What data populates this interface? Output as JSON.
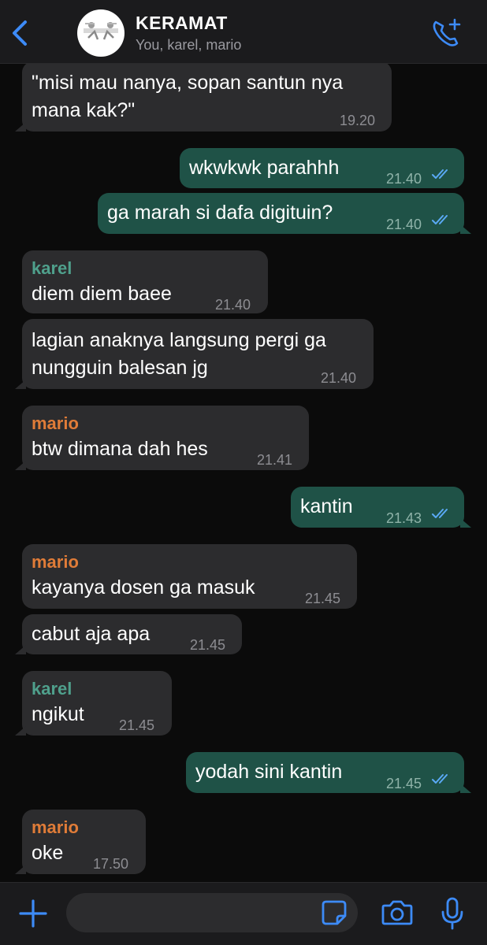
{
  "header": {
    "title": "KERAMAT",
    "subtitle": "You, karel, mario",
    "back_icon": "chevron-left-icon",
    "call_icon": "add-call-icon",
    "accent_color": "#3d8bf7"
  },
  "messages": [
    {
      "direction": "in",
      "sender": "",
      "lines": [
        "\"misi mau nanya, sopan santun nya",
        "mana kak?\""
      ],
      "time": "19.20"
    },
    {
      "direction": "out",
      "sender": "",
      "lines": [
        "wkwkwk parahhh"
      ],
      "time": "21.40",
      "read": true
    },
    {
      "direction": "out",
      "sender": "",
      "lines": [
        "ga marah si dafa digituin?"
      ],
      "time": "21.40",
      "read": true
    },
    {
      "direction": "in",
      "sender": "karel",
      "lines": [
        "diem diem baee"
      ],
      "time": "21.40"
    },
    {
      "direction": "in",
      "sender": "",
      "lines": [
        "lagian anaknya langsung pergi ga",
        "nungguin balesan jg"
      ],
      "time": "21.40"
    },
    {
      "direction": "in",
      "sender": "mario",
      "lines": [
        "btw dimana dah hes"
      ],
      "time": "21.41"
    },
    {
      "direction": "out",
      "sender": "",
      "lines": [
        "kantin"
      ],
      "time": "21.43",
      "read": true
    },
    {
      "direction": "in",
      "sender": "mario",
      "lines": [
        "kayanya dosen ga masuk"
      ],
      "time": "21.45"
    },
    {
      "direction": "in",
      "sender": "",
      "lines": [
        "cabut aja apa"
      ],
      "time": "21.45"
    },
    {
      "direction": "in",
      "sender": "karel",
      "lines": [
        "ngikut"
      ],
      "time": "21.45"
    },
    {
      "direction": "out",
      "sender": "",
      "lines": [
        "yodah sini kantin"
      ],
      "time": "21.45",
      "read": true
    },
    {
      "direction": "in",
      "sender": "mario",
      "lines": [
        "oke"
      ],
      "time": "17.50"
    }
  ],
  "colors": {
    "incoming_bubble": "#2c2c2e",
    "outgoing_bubble": "#1f5247",
    "karel": "#4fa08c",
    "mario": "#e07c38",
    "read_ticks": "#5aa9f5"
  },
  "composer": {
    "placeholder": "",
    "plus_icon": "plus-icon",
    "sticker_icon": "sticker-icon",
    "camera_icon": "camera-icon",
    "mic_icon": "microphone-icon"
  }
}
